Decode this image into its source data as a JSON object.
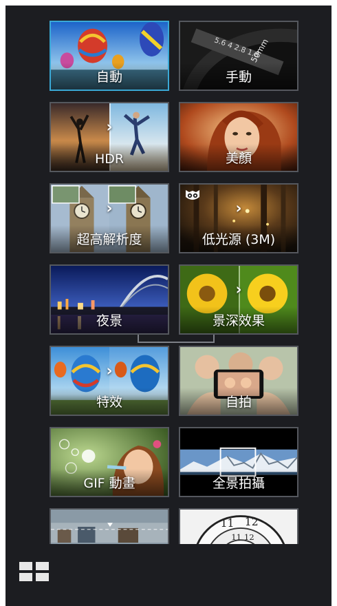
{
  "modes": [
    {
      "id": "auto",
      "label": "自動",
      "selected": true
    },
    {
      "id": "manual",
      "label": "手動",
      "selected": false
    },
    {
      "id": "hdr",
      "label": "HDR",
      "selected": false
    },
    {
      "id": "beautification",
      "label": "美顏",
      "selected": false
    },
    {
      "id": "super-resolution",
      "label": "超高解析度",
      "selected": false
    },
    {
      "id": "low-light",
      "label": "低光源 (3M)",
      "selected": false
    },
    {
      "id": "night",
      "label": "夜景",
      "selected": false
    },
    {
      "id": "depth-of-field",
      "label": "景深效果",
      "selected": false
    },
    {
      "id": "effect",
      "label": "特效",
      "selected": false
    },
    {
      "id": "selfie",
      "label": "自拍",
      "selected": false
    },
    {
      "id": "gif-animation",
      "label": "GIF 動畫",
      "selected": false
    },
    {
      "id": "panorama",
      "label": "全景拍攝",
      "selected": false
    },
    {
      "id": "miniature",
      "label": "",
      "selected": false
    },
    {
      "id": "time-rewind",
      "label": "",
      "selected": false
    }
  ],
  "icons": {
    "mode_toggle": "grid-view-icon",
    "owl": "owl-icon",
    "arrow": "chevron-right-icon"
  },
  "colors": {
    "background": "#1c1d21",
    "selected_border": "#3aa9d6",
    "tile_border": "#55585e"
  }
}
